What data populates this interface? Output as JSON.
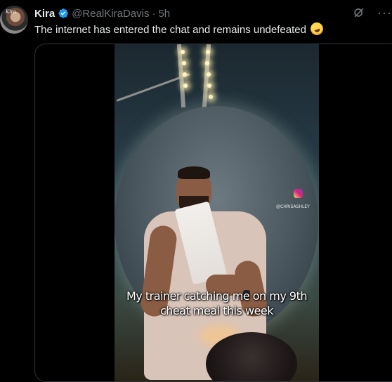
{
  "tweet": {
    "author_name": "Kira",
    "handle": "@RealKiraDavis",
    "separator": "·",
    "time": "5h",
    "text": "The internet has entered the chat and remains undefeated",
    "avatar_caption": "Kira",
    "verified_color": "#1d9bf0",
    "icons": [
      "verified-icon",
      "grok-icon",
      "more-icon",
      "rolling-laughing-emoji"
    ]
  },
  "media": {
    "watermark_handle": "@CHRISASHLEY",
    "caption_line1": "My trainer catching me on my 9th",
    "caption_line2": "cheat meal this week"
  }
}
